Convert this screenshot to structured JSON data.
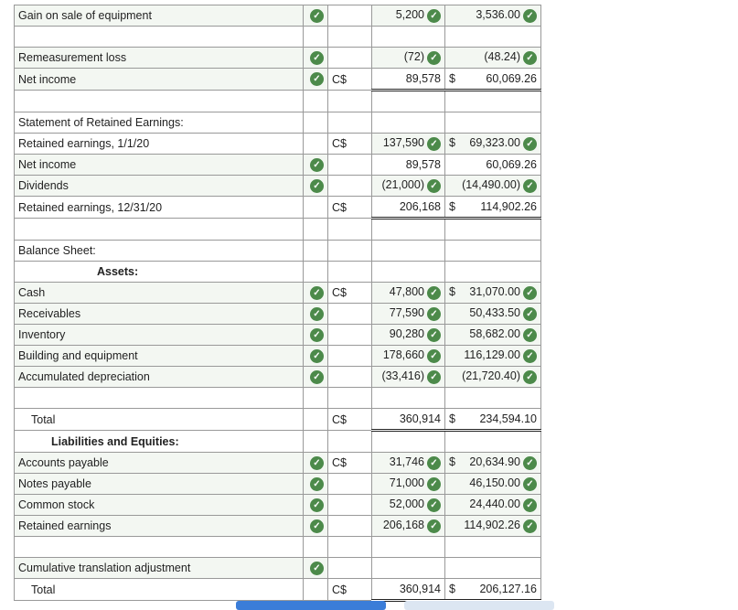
{
  "colors": {
    "check": "#4c8a4a",
    "input_bg": "#f3f7f2",
    "primary_button": "#3b7dd8",
    "secondary_button": "#dce6f2"
  },
  "check_icon": "check-circle-icon",
  "rows": [
    {
      "label": "Gain on sale of equipment",
      "check": true,
      "cur": "",
      "v1": "5,200",
      "c1": true,
      "v2": "3,536.00",
      "c2": true
    },
    {
      "label": ""
    },
    {
      "label": "Remeasurement loss",
      "check": true,
      "cur": "",
      "v1": "(72)",
      "c1": true,
      "v2": "(48.24)",
      "c2": true
    },
    {
      "label": "Net income",
      "check": true,
      "cur": "C$",
      "v1": "89,578",
      "v2d": "$",
      "v2": "60,069.26",
      "ul": "dbl"
    },
    {
      "label": ""
    },
    {
      "label": "Statement of Retained Earnings:"
    },
    {
      "label": "Retained earnings, 1/1/20",
      "cur": "C$",
      "v1": "137,590",
      "c1": true,
      "v2d": "$",
      "v2": "69,323.00",
      "c2": true
    },
    {
      "label": "Net income",
      "check": true,
      "v1": "89,578",
      "v2": "60,069.26"
    },
    {
      "label": "Dividends",
      "check": true,
      "v1": "(21,000)",
      "c1": true,
      "v2": "(14,490.00)",
      "c2": true
    },
    {
      "label": "Retained earnings, 12/31/20",
      "cur": "C$",
      "v1": "206,168",
      "v2d": "$",
      "v2": "114,902.26",
      "ul": "dbl",
      "top": true
    },
    {
      "label": ""
    },
    {
      "label": "Balance Sheet:"
    },
    {
      "label": "Assets:",
      "style": "hdr"
    },
    {
      "label": "Cash",
      "check": true,
      "cur": "C$",
      "v1": "47,800",
      "c1": true,
      "v2d": "$",
      "v2": "31,070.00",
      "c2": true
    },
    {
      "label": "Receivables",
      "check": true,
      "v1": "77,590",
      "c1": true,
      "v2": "50,433.50",
      "c2": true
    },
    {
      "label": "Inventory",
      "check": true,
      "v1": "90,280",
      "c1": true,
      "v2": "58,682.00",
      "c2": true
    },
    {
      "label": "Building and equipment",
      "check": true,
      "v1": "178,660",
      "c1": true,
      "v2": "116,129.00",
      "c2": true
    },
    {
      "label": "Accumulated depreciation",
      "check": true,
      "v1": "(33,416)",
      "c1": true,
      "v2": "(21,720.40)",
      "c2": true
    },
    {
      "label": ""
    },
    {
      "label": "Total",
      "style": "ind",
      "cur": "C$",
      "v1": "360,914",
      "v2d": "$",
      "v2": "234,594.10",
      "ul": "dbl",
      "top": true
    },
    {
      "label": "Liabilities and Equities:",
      "style": "hdr2"
    },
    {
      "label": "Accounts payable",
      "check": true,
      "cur": "C$",
      "v1": "31,746",
      "c1": true,
      "v2d": "$",
      "v2": "20,634.90",
      "c2": true
    },
    {
      "label": "Notes payable",
      "check": true,
      "v1": "71,000",
      "c1": true,
      "v2": "46,150.00",
      "c2": true
    },
    {
      "label": "Common stock",
      "check": true,
      "v1": "52,000",
      "c1": true,
      "v2": "24,440.00",
      "c2": true
    },
    {
      "label": "Retained earnings",
      "check": true,
      "v1": "206,168",
      "c1": true,
      "v2": "114,902.26",
      "c2": true
    },
    {
      "label": ""
    },
    {
      "label": "Cumulative translation adjustment",
      "check": true
    },
    {
      "label": "Total",
      "style": "ind",
      "cur": "C$",
      "v1": "360,914",
      "v2d": "$",
      "v2": "206,127.16",
      "ul": "dbl",
      "top": true
    }
  ]
}
